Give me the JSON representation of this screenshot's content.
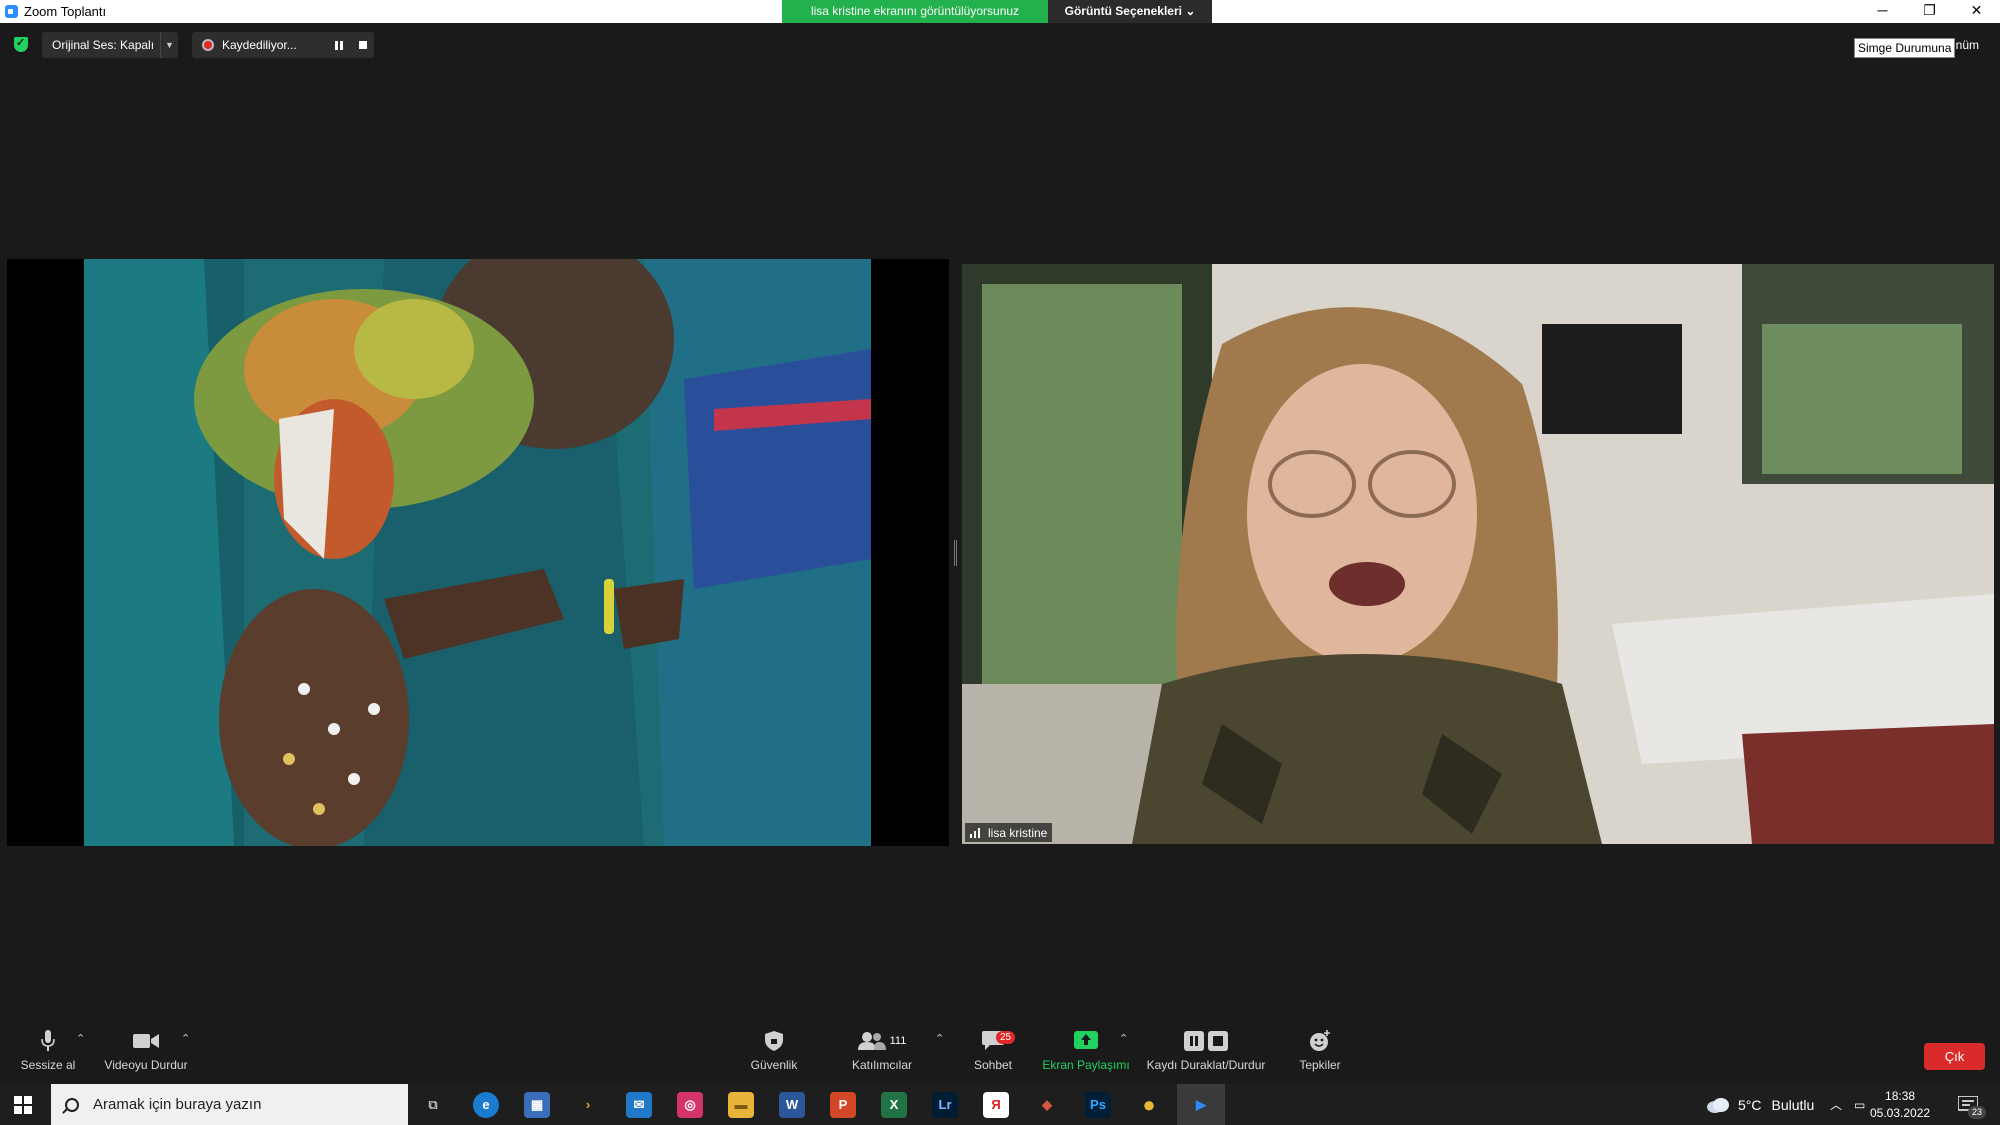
{
  "window": {
    "title": "Zoom Toplantı",
    "share_banner": "lisa kristine  ekranını görüntülüyorsunuz",
    "view_options": "Görüntü Seçenekleri",
    "controls": {
      "minimize": "─",
      "restore": "❐",
      "close": "✕"
    }
  },
  "topbar": {
    "original_audio": "Orijinal Ses: Kapalı",
    "recording": "Kaydediliyor...",
    "tooltip": "Simge Durumuna",
    "view_label": "inüm"
  },
  "participant": {
    "name": "lisa kristine"
  },
  "toolbar": {
    "mute": "Sessize al",
    "video": "Videoyu Durdur",
    "security": "Güvenlik",
    "participants": "Katılımcılar",
    "participants_count": "111",
    "chat": "Sohbet",
    "chat_badge": "25",
    "share": "Ekran Paylaşımı",
    "record": "Kaydı Duraklat/Durdur",
    "reactions": "Tepkiler",
    "exit": "Çık"
  },
  "taskbar": {
    "search_placeholder": "Aramak için buraya yazın",
    "weather_temp": "5°C",
    "weather_desc": "Bulutlu",
    "time": "18:38",
    "date": "05.03.2022",
    "notification_count": "23",
    "apps": [
      {
        "name": "task-view",
        "glyph": "⧉"
      },
      {
        "name": "edge",
        "glyph": "e"
      },
      {
        "name": "store",
        "glyph": "▦"
      },
      {
        "name": "terminal",
        "glyph": "›"
      },
      {
        "name": "mail",
        "glyph": "✉"
      },
      {
        "name": "creative-cloud",
        "glyph": "◎"
      },
      {
        "name": "file-explorer",
        "glyph": "▬"
      },
      {
        "name": "word",
        "glyph": "W"
      },
      {
        "name": "powerpoint",
        "glyph": "P"
      },
      {
        "name": "excel",
        "glyph": "X"
      },
      {
        "name": "lightroom",
        "glyph": "Lr"
      },
      {
        "name": "yandex",
        "glyph": "Я"
      },
      {
        "name": "box-app",
        "glyph": "◆"
      },
      {
        "name": "photoshop",
        "glyph": "Ps"
      },
      {
        "name": "chrome",
        "glyph": "●"
      },
      {
        "name": "zoom",
        "glyph": "▶"
      }
    ]
  },
  "colors": {
    "share_green": "#22b14c",
    "exit_red": "#d92b2b",
    "share_active": "#23d160",
    "background": "#1a1a1a"
  }
}
